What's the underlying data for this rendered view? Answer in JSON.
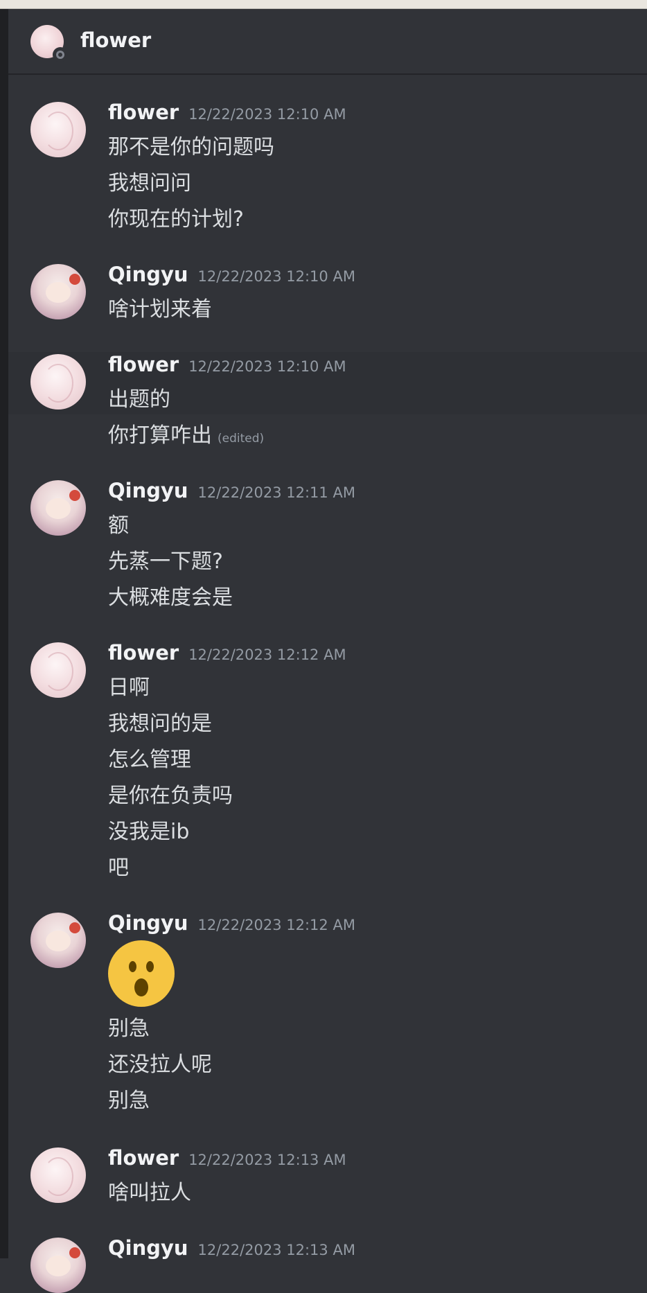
{
  "channel": {
    "title": "flower",
    "avatar": "user-avatar",
    "status": "offline"
  },
  "messages": [
    {
      "author": "flower",
      "timestamp": "12/22/2023 12:10 AM",
      "avatar": "flower-avatar",
      "lines": [
        "那不是你的问题吗",
        "我想问问",
        "你现在的计划?"
      ]
    },
    {
      "author": "Qingyu",
      "timestamp": "12/22/2023 12:10 AM",
      "avatar": "qingyu-avatar",
      "lines": [
        "啥计划来着"
      ]
    },
    {
      "author": "flower",
      "timestamp": "12/22/2023 12:10 AM",
      "avatar": "flower-avatar",
      "lines": [
        "出题的",
        "你打算咋出"
      ],
      "edited_label": "(edited)"
    },
    {
      "author": "Qingyu",
      "timestamp": "12/22/2023 12:11 AM",
      "avatar": "qingyu-avatar",
      "lines": [
        "额",
        "先蒸一下题?",
        "大概难度会是"
      ]
    },
    {
      "author": "flower",
      "timestamp": "12/22/2023 12:12 AM",
      "avatar": "flower-avatar",
      "lines": [
        "日啊",
        "我想问的是",
        "怎么管理",
        "是你在负责吗",
        "没我是ib",
        "吧"
      ]
    },
    {
      "author": "Qingyu",
      "timestamp": "12/22/2023 12:12 AM",
      "avatar": "qingyu-avatar",
      "emoji": "open-mouth-emoji",
      "lines": [
        "别急",
        "还没拉人呢",
        "别急"
      ]
    },
    {
      "author": "flower",
      "timestamp": "12/22/2023 12:13 AM",
      "avatar": "flower-avatar",
      "lines": [
        "啥叫拉人"
      ]
    },
    {
      "author": "Qingyu",
      "timestamp": "12/22/2023 12:13 AM",
      "avatar": "qingyu-avatar",
      "lines": []
    }
  ]
}
